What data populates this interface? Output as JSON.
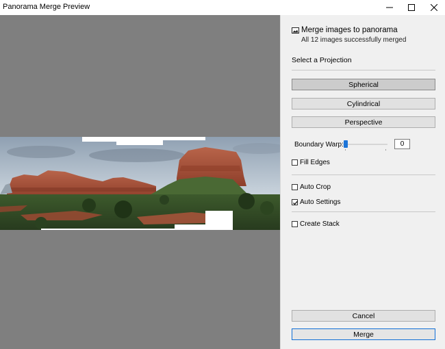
{
  "window": {
    "title": "Panorama Merge Preview",
    "minimize_icon": "minimize-icon",
    "maximize_icon": "maximize-icon",
    "close_icon": "close-icon"
  },
  "preview": {
    "background_color": "#7f7f7f",
    "sky_color": "#b9c6d3",
    "rock_color": "#a84e36",
    "vegetation_color": "#2f4a26"
  },
  "panel": {
    "header_icon": "panorama-image-icon",
    "header_title": "Merge images to panorama",
    "header_subtitle": "All 12 images successfully merged",
    "projection_label": "Select a Projection",
    "projections": [
      "Spherical",
      "Cylindrical",
      "Perspective"
    ],
    "selected_projection": "Spherical",
    "boundary_warp": {
      "label": "Boundary Warp:",
      "value": "0",
      "slider_fraction": 0
    },
    "options": {
      "fill_edges": {
        "label": "Fill Edges",
        "checked": false
      },
      "auto_crop": {
        "label": "Auto Crop",
        "checked": false
      },
      "auto_settings": {
        "label": "Auto Settings",
        "checked": true
      },
      "create_stack": {
        "label": "Create Stack",
        "checked": false
      }
    },
    "cancel_label": "Cancel",
    "merge_label": "Merge",
    "accent_color": "#1d75d8"
  }
}
